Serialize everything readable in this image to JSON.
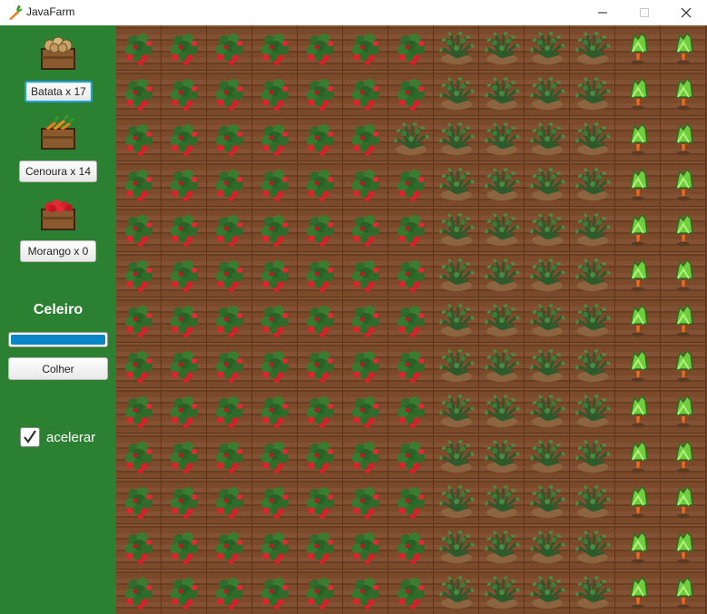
{
  "window": {
    "title": "JavaFarm",
    "icon": "carrot-icon"
  },
  "sidebar": {
    "items": [
      {
        "crop": "potato",
        "icon": "potato-crate-icon",
        "button_label": "Batata x 17"
      },
      {
        "crop": "carrot",
        "icon": "carrot-crate-icon",
        "button_label": "Cenoura x 14"
      },
      {
        "crop": "strawberry",
        "icon": "strawberry-crate-icon",
        "button_label": "Morango x 0"
      }
    ],
    "barn": {
      "title": "Celeiro",
      "progress": 1.0,
      "harvest_label": "Colher"
    },
    "speed": {
      "label": "acelerar",
      "checked": true
    }
  },
  "field": {
    "rows": 13,
    "cols": 13,
    "column_crops": [
      "strawberry",
      "strawberry",
      "strawberry",
      "strawberry",
      "strawberry",
      "strawberry",
      "strawberry",
      "potato",
      "potato",
      "potato",
      "potato",
      "carrot",
      "carrot"
    ],
    "exceptions": [
      {
        "row": 0,
        "col": 6,
        "crop": "strawberry"
      },
      {
        "row": 1,
        "col": 6,
        "crop": "strawberry"
      },
      {
        "row": 2,
        "col": 6,
        "crop": "potato"
      }
    ]
  },
  "colors": {
    "sidebar": "#2b8131",
    "progress": "#0b86c6",
    "focus": "#2a9fd6",
    "soil": "#7a4a2b"
  }
}
